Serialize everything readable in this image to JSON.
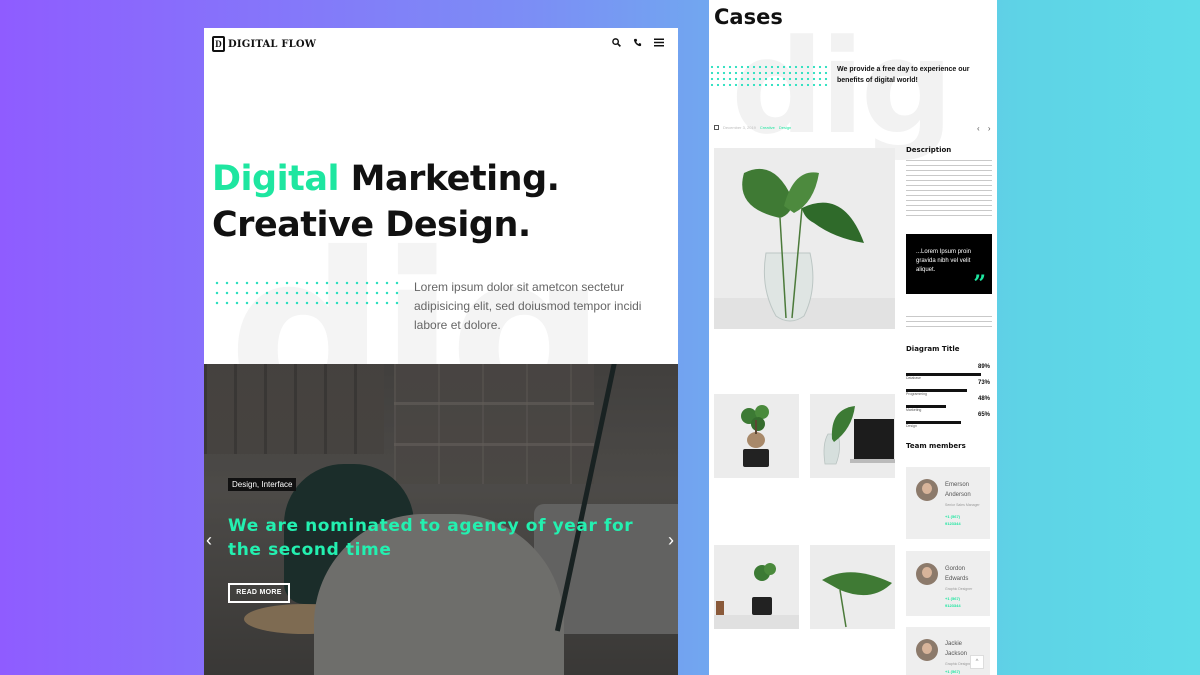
{
  "left": {
    "logo_mark": "D",
    "logo_text": "DIGITAL FLOW",
    "header_icons": [
      "search-icon",
      "phone-icon",
      "menu-icon"
    ],
    "bg_text": "dig",
    "hero": {
      "accent_word": "Digital",
      "line1_rest": " Marketing.",
      "line2": "Creative Design.",
      "description": "Lorem ipsum dolor sit ametcon sectetur adipisicing elit, sed doiusmod tempor incidi labore et dolore."
    },
    "slide": {
      "tag": "Design, Interface",
      "title": "We are nominated to agency of year for the second time",
      "button": "READ MORE",
      "prev": "‹",
      "next": "›"
    }
  },
  "right": {
    "title": "Cases",
    "bg_text": "dig",
    "intro": "We provide a free day to experience our benefits of digital world!",
    "meta": {
      "date": "December 3, 2019",
      "cat1": "Creative",
      "cat2": "Design"
    },
    "nav": "‹ ›",
    "description_heading": "Description",
    "quote": "...Lorem Ipsum proin gravida nibh vel velit aliquet.",
    "quote_mark": "”",
    "diagram_heading": "Diagram Title",
    "skills": [
      {
        "label": "Database",
        "percent": 89
      },
      {
        "label": "Programming",
        "percent": 73
      },
      {
        "label": "Marketing",
        "percent": 48
      },
      {
        "label": "Design",
        "percent": 65
      }
    ],
    "team_heading": "Team members",
    "members": [
      {
        "first": "Emerson",
        "last": "Anderson",
        "role": "Senior Sales Manager",
        "phone1": "+1 (567)",
        "phone2": "9123344"
      },
      {
        "first": "Gordon",
        "last": "Edwards",
        "role": "Graphic Designer",
        "phone1": "+1 (567)",
        "phone2": "9123344"
      },
      {
        "first": "Jackie",
        "last": "Jackson",
        "role": "Graphic Designer",
        "phone1": "+1 (567)",
        "phone2": ""
      }
    ],
    "scroll_top": "^",
    "accent_color": "#1ee6a0"
  }
}
